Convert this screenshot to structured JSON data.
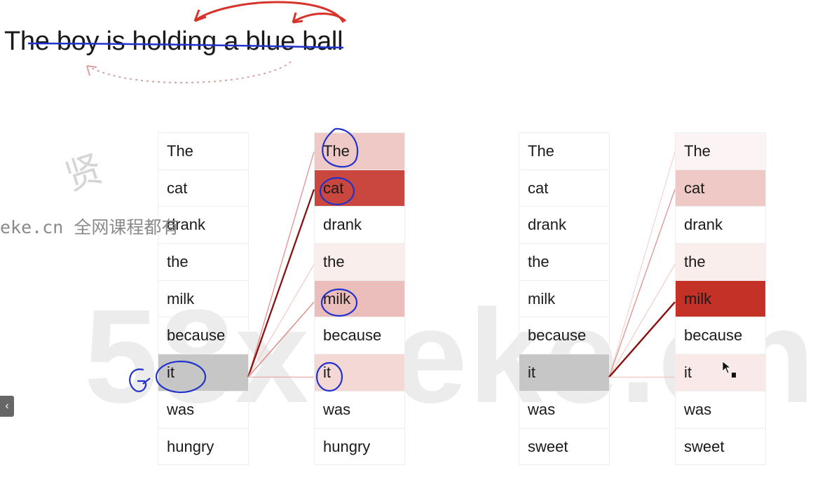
{
  "sentence": "The boy is holding a blue ball",
  "watermark": {
    "big": "58xueke.cn",
    "site": "eke.cn 全网课程都有",
    "glyph": "贤"
  },
  "panels": [
    {
      "query_column": {
        "tokens": [
          "The",
          "cat",
          "drank",
          "the",
          "milk",
          "because",
          "it",
          "was",
          "hungry"
        ],
        "highlight_index": 6,
        "highlight_color": "#c6c6c6"
      },
      "attention_column": {
        "tokens": [
          "The",
          "cat",
          "drank",
          "the",
          "milk",
          "because",
          "it",
          "was",
          "hungry"
        ],
        "weights": [
          0.25,
          0.85,
          0.0,
          0.08,
          0.3,
          0.0,
          0.18,
          0.0,
          0.0
        ]
      }
    },
    {
      "query_column": {
        "tokens": [
          "The",
          "cat",
          "drank",
          "the",
          "milk",
          "because",
          "it",
          "was",
          "sweet"
        ],
        "highlight_index": 6,
        "highlight_color": "#c6c6c6"
      },
      "attention_column": {
        "tokens": [
          "The",
          "cat",
          "drank",
          "the",
          "milk",
          "because",
          "it",
          "was",
          "sweet"
        ],
        "weights": [
          0.05,
          0.25,
          0.0,
          0.08,
          0.95,
          0.0,
          0.1,
          0.0,
          0.0
        ]
      }
    }
  ],
  "colors": {
    "attention_base": "#c0261c",
    "annotation_blue": "#2233cc",
    "arrow_red": "#d8332a"
  },
  "ui": {
    "collapse_label": "‹"
  }
}
